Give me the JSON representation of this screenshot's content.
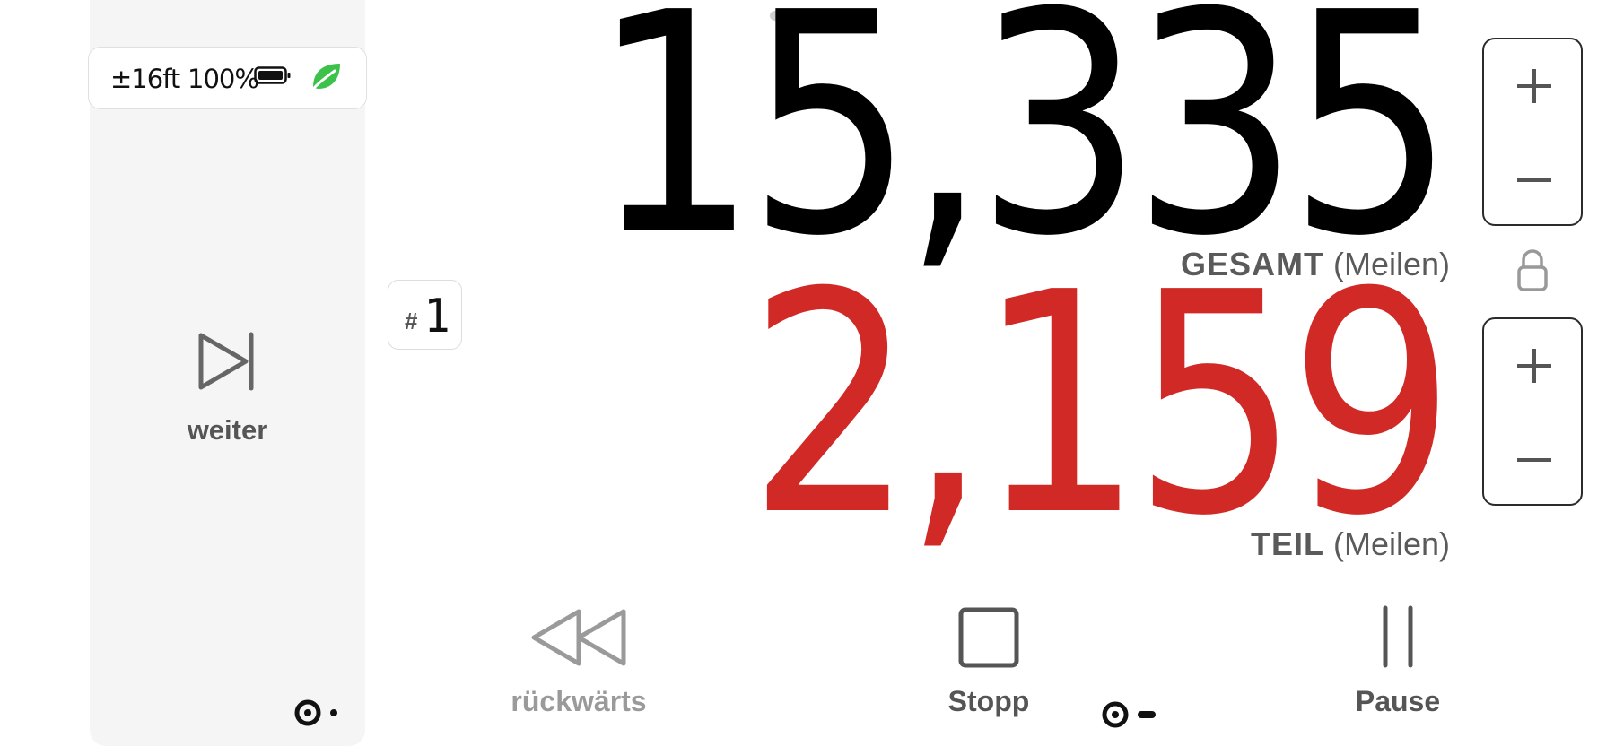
{
  "status": {
    "gps_accuracy": "±16ft",
    "battery_percent": "100%",
    "battery_icon": "battery-full-icon",
    "eco_icon": "leaf-icon",
    "eco_color": "#3cc24a"
  },
  "sidebar": {
    "next_label": "weiter",
    "next_icon": "skip-forward-icon"
  },
  "trip": {
    "hash": "#",
    "number": "1"
  },
  "odometer": {
    "total_value": "15,335",
    "total_label": "GESAMT",
    "total_unit": "(Meilen)",
    "partial_value": "2,159",
    "partial_label": "TEIL",
    "partial_unit": "(Meilen)",
    "total_color": "#000000",
    "partial_color": "#d12a26"
  },
  "controls": {
    "back_label": "rückwärts",
    "stop_label": "Stopp",
    "pause_label": "Pause"
  },
  "icons": {
    "plus": "plus-icon",
    "minus": "minus-icon",
    "lock": "lock-icon",
    "toggle": "toggle-icon"
  }
}
